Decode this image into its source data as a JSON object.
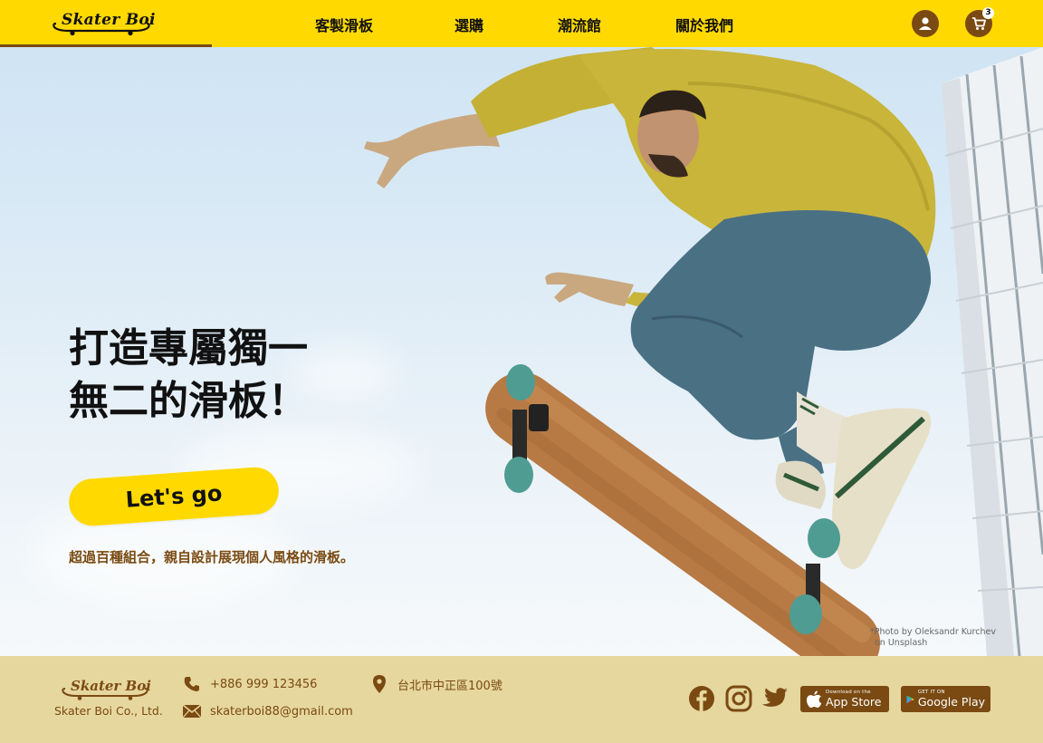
{
  "brand": {
    "logo_text": "Skater Boi",
    "colors": {
      "accent": "#ffd900",
      "brown": "#7a4a12",
      "footer_bg": "#e6d79e",
      "text": "#111111"
    }
  },
  "header": {
    "nav": [
      {
        "label": "客製滑板"
      },
      {
        "label": "選購"
      },
      {
        "label": "潮流館"
      },
      {
        "label": "關於我們"
      }
    ],
    "icons": {
      "account": "user-icon",
      "cart": "cart-icon"
    },
    "cart_count": "3"
  },
  "hero": {
    "headline_line1": "打造專屬獨一",
    "headline_line2": "無二的滑板！",
    "cta_label": "Let's go",
    "tagline": "超過百種組合，親自設計展現個人風格的滑板。",
    "photo_credit_line1": "*Photo by Oleksandr Kurchev",
    "photo_credit_line2": "on Unsplash"
  },
  "footer": {
    "company": "Skater Boi Co., Ltd.",
    "phone": "+886 999 123456",
    "email": "skaterboi88@gmail.com",
    "address": "台北市中正區100號",
    "social": [
      "facebook-icon",
      "instagram-icon",
      "twitter-icon"
    ],
    "app_store": {
      "small": "Download on the",
      "big": "App Store"
    },
    "google_play": {
      "small": "GET IT ON",
      "big": "Google Play"
    }
  }
}
